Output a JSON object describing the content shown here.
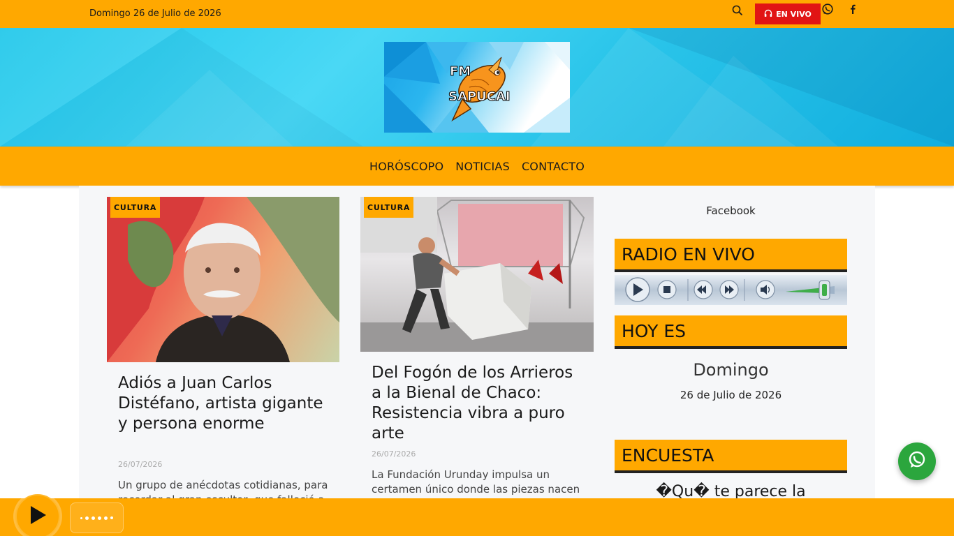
{
  "topbar": {
    "date": "Domingo 26 de Julio de 2026",
    "live_label": "EN VIVO",
    "icons": [
      "search-icon",
      "headphones-icon",
      "whatsapp-icon",
      "facebook-icon"
    ]
  },
  "header": {
    "logo_text_line1": "FM",
    "logo_text_line2": "SAPUCAI"
  },
  "nav": {
    "items": [
      "HORÓSCOPO",
      "NOTICIAS",
      "CONTACTO"
    ]
  },
  "articles": [
    {
      "category": "CULTURA",
      "title": "Adiós a Juan Carlos Distéfano, artista gigante y persona enorme",
      "date": "26/07/2026",
      "excerpt": "Un grupo de anécdotas cotidianas, para recordar al gran escultor, que falleció a"
    },
    {
      "category": "CULTURA",
      "title": "Del Fogón de los Arrieros a la Bienal de Chaco: Resistencia vibra a puro arte",
      "date": "26/07/2026",
      "excerpt": "La Fundación Urunday impulsa un certamen único donde las piezas nacen"
    }
  ],
  "sidebar": {
    "facebook_label": "Facebook",
    "radio_title": "RADIO EN VIVO",
    "hoy_title": "HOY ES",
    "hoy_day": "Domingo",
    "hoy_date": "26 de Julio de 2026",
    "poll_title": "ENCUESTA",
    "poll_question": "�Qu� te parece la"
  },
  "colors": {
    "brand_orange": "#ffa800",
    "live_red": "#e11414",
    "whatsapp_green": "#2ba63d",
    "header_cyan": "#2bc5ea"
  }
}
